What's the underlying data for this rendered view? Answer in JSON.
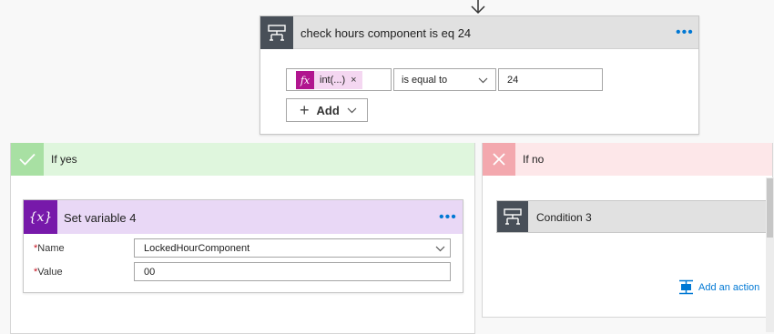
{
  "condition": {
    "title": "check hours component is eq 24",
    "left_token": "int(...)",
    "operator": "is equal to",
    "right_value": "24",
    "add_label": "Add"
  },
  "if_yes": {
    "title": "If yes",
    "action": {
      "title": "Set variable 4",
      "icon_text": "{x}",
      "fields": [
        {
          "label": "Name",
          "value": "LockedHourComponent"
        },
        {
          "label": "Value",
          "value": "00"
        }
      ]
    }
  },
  "if_no": {
    "title": "If no",
    "action": {
      "title": "Condition 3"
    },
    "add_action_label": "Add an action"
  },
  "icons": {
    "fx": "fx",
    "close": "×",
    "plus": "+"
  },
  "colors": {
    "accent_blue": "#0078d4",
    "condition_dark": "#484f58",
    "yes_green": "#dff6dd",
    "no_red": "#fde7e9",
    "variable_purple": "#7719aa",
    "expression_magenta": "#b1158f"
  }
}
